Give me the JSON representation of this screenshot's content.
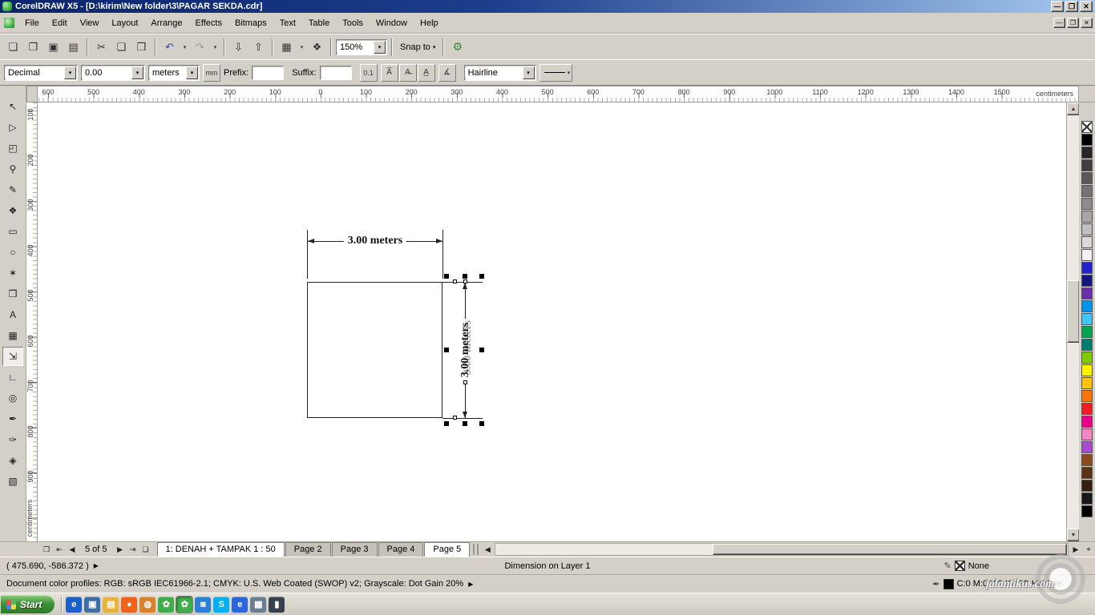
{
  "window": {
    "title": "CorelDRAW X5 - [D:\\kirim\\New folder\\3\\PAGAR SEKDA.cdr]"
  },
  "icons": {
    "minimize": "—",
    "restore": "❐",
    "close": "✕",
    "dropdown": "▾",
    "flyout_arrow": "▶",
    "scroll_up": "▲",
    "scroll_down": "▼",
    "scroll_left": "◀",
    "scroll_right": "▶",
    "nav_goto": "❐",
    "nav_first": "⇤",
    "nav_prev": "◀",
    "nav_next": "▶",
    "nav_last": "⇥",
    "nav_add_page": "❏",
    "navigator_popup": "⌖",
    "outline_pen": "✒",
    "fill_pencil": "✎",
    "options": "⚙",
    "show_units": "mm",
    "dynamic_dim": "0.1",
    "text_angle": "∡"
  },
  "menu": {
    "items": [
      "File",
      "Edit",
      "View",
      "Layout",
      "Arrange",
      "Effects",
      "Bitmaps",
      "Text",
      "Table",
      "Tools",
      "Window",
      "Help"
    ]
  },
  "toolbar": {
    "buttons": [
      {
        "name": "new",
        "glyph": "❏"
      },
      {
        "name": "open",
        "glyph": "❐"
      },
      {
        "name": "save",
        "glyph": "▣"
      },
      {
        "name": "print",
        "glyph": "▤"
      },
      {
        "divider": true
      },
      {
        "name": "cut",
        "glyph": "✂"
      },
      {
        "name": "copy",
        "glyph": "❑"
      },
      {
        "name": "paste",
        "glyph": "❒"
      },
      {
        "divider": true
      },
      {
        "name": "undo",
        "glyph": "↶",
        "dropdown": true,
        "color": "#2a52b0"
      },
      {
        "name": "redo",
        "glyph": "↷",
        "dropdown": true,
        "disabled": true
      },
      {
        "divider": true
      },
      {
        "name": "import",
        "glyph": "⇩"
      },
      {
        "name": "export",
        "glyph": "⇧"
      },
      {
        "divider": true
      },
      {
        "name": "application-launcher",
        "glyph": "▦",
        "dropdown": true
      },
      {
        "name": "welcome-screen",
        "glyph": "❖"
      },
      {
        "divider": true
      }
    ],
    "zoom_level": "150%",
    "snap_to_label": "Snap to"
  },
  "property_bar": {
    "dimension_style": "Decimal",
    "dimension_precision": "0.00",
    "dimension_units": "meters",
    "prefix_label": "Prefix:",
    "prefix_value": "",
    "suffix_label": "Suffix:",
    "suffix_value": "",
    "text_position_glyphs": [
      "A̅",
      "A̶",
      "A̲"
    ],
    "outline_width": "Hairline"
  },
  "rulers": {
    "horizontal_labels": [
      "600",
      "500",
      "400",
      "300",
      "200",
      "100",
      "0",
      "100",
      "200",
      "300",
      "400",
      "500",
      "600",
      "700",
      "800",
      "900",
      "1000",
      "1100",
      "1200",
      "1300",
      "1400",
      "1500"
    ],
    "horizontal_unit": "centimeters",
    "vertical_labels": [
      "100",
      "200",
      "300",
      "400",
      "500",
      "600",
      "700",
      "800",
      "900"
    ],
    "vertical_unit": "centimeters"
  },
  "toolbox": {
    "tools": [
      {
        "name": "pick-tool",
        "glyph": "↖"
      },
      {
        "name": "shape-tool",
        "glyph": "▷"
      },
      {
        "name": "crop-tool",
        "glyph": "◰"
      },
      {
        "name": "zoom-tool",
        "glyph": "⚲"
      },
      {
        "name": "freehand-tool",
        "glyph": "✎"
      },
      {
        "name": "smart-fill-tool",
        "glyph": "❖"
      },
      {
        "name": "rectangle-tool",
        "glyph": "▭"
      },
      {
        "name": "ellipse-tool",
        "glyph": "○"
      },
      {
        "name": "polygon-tool",
        "glyph": "✶"
      },
      {
        "name": "basic-shapes-tool",
        "glyph": "❒"
      },
      {
        "name": "text-tool",
        "glyph": "A"
      },
      {
        "name": "table-tool",
        "glyph": "▦"
      },
      {
        "name": "parallel-dimension-tool",
        "glyph": "⇲",
        "pressed": true
      },
      {
        "name": "connector-tool",
        "glyph": "∟"
      },
      {
        "name": "blend-tool",
        "glyph": "◎"
      },
      {
        "name": "color-eyedropper-tool",
        "glyph": "✒"
      },
      {
        "name": "outline-pen-tool",
        "glyph": "✑"
      },
      {
        "name": "fill-tool",
        "glyph": "◈"
      },
      {
        "name": "interactive-fill-tool",
        "glyph": "▧"
      }
    ]
  },
  "canvas": {
    "horizontal_dimension_label": "3.00 meters",
    "vertical_dimension_label": "3.00 meters"
  },
  "navigator": {
    "page_indicator": "5 of 5",
    "tabs": [
      "1: DENAH + TAMPAK 1 : 50",
      "Page 2",
      "Page 3",
      "Page 4",
      "Page 5"
    ],
    "active_tab": "Page 5"
  },
  "status_bar": {
    "coordinates": "( 475.690, -586.372 )",
    "object_info": "Dimension on Layer 1",
    "fill_status": "None",
    "outline_color_values": "C:0 M:0 Y:0 K:100",
    "outline_width": "Hairline",
    "color_profiles": "Document color profiles: RGB: sRGB IEC61966-2.1; CMYK: U.S. Web Coated (SWOP) v2; Grayscale: Dot Gain 20%"
  },
  "palette": {
    "colors": [
      "none",
      "#000000",
      "#262626",
      "#3f3f3f",
      "#595959",
      "#737373",
      "#8c8c8c",
      "#a6a6a6",
      "#bfbfbf",
      "#d9d9d9",
      "#f2f2f2",
      "#2323c8",
      "#15157f",
      "#6a30a8",
      "#0095e8",
      "#3fc6f5",
      "#00a550",
      "#007d70",
      "#7ecb00",
      "#fff200",
      "#ffc20e",
      "#f97306",
      "#ee1c25",
      "#e8008a",
      "#f883c5",
      "#a54ccc",
      "#8a4b21",
      "#5b3317",
      "#34200f",
      "#171717",
      "#000000"
    ]
  },
  "taskbar": {
    "start_label": "Start",
    "quick_launch": [
      {
        "name": "internet-explorer",
        "glyph": "e",
        "color": "#1d5fc8"
      },
      {
        "name": "show-desktop",
        "glyph": "▣",
        "color": "#3a6ea5"
      },
      {
        "name": "folder",
        "glyph": "▤",
        "color": "#e8b33d"
      },
      {
        "name": "firefox",
        "glyph": "●",
        "color": "#f06218"
      },
      {
        "name": "media-player",
        "glyph": "◍",
        "color": "#d9822b"
      },
      {
        "name": "coreldraw",
        "glyph": "✿",
        "color": "#3fae49"
      },
      {
        "name": "coreldraw-window",
        "glyph": "✿",
        "color": "#3fae49",
        "pressed": true
      },
      {
        "name": "photo-paint",
        "glyph": "◙",
        "color": "#2b7fd4"
      },
      {
        "name": "skype",
        "glyph": "S",
        "color": "#00aff0"
      },
      {
        "name": "browser",
        "glyph": "e",
        "color": "#2a66dd"
      },
      {
        "name": "file-manager",
        "glyph": "▦",
        "color": "#6b7f93"
      },
      {
        "name": "terminal",
        "glyph": "▮",
        "color": "#39404d"
      }
    ]
  },
  "watermark": {
    "text": "jalantikus.com"
  }
}
